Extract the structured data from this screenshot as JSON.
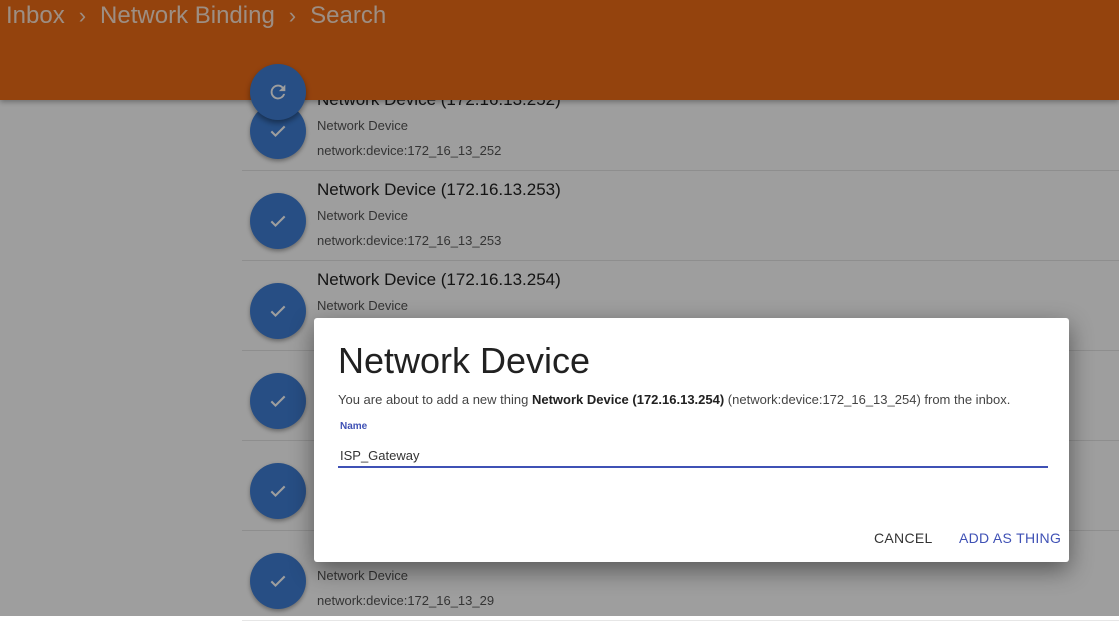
{
  "breadcrumb": {
    "items": [
      "Inbox",
      "Network Binding",
      "Search"
    ],
    "separator": "›"
  },
  "colors": {
    "appbar": "#ef6c16",
    "fab": "#3f7fd6",
    "accent": "#3f51b5"
  },
  "inbox": {
    "rows": [
      {
        "title": "Network Device (172.16.13.252)",
        "type": "Network Device",
        "uid": "network:device:172_16_13_252"
      },
      {
        "title": "Network Device (172.16.13.253)",
        "type": "Network Device",
        "uid": "network:device:172_16_13_253"
      },
      {
        "title": "Network Device (172.16.13.254)",
        "type": "Network Device",
        "uid": ""
      },
      {
        "title": "",
        "type": "",
        "uid": ""
      },
      {
        "title": "",
        "type": "",
        "uid": ""
      },
      {
        "title": "",
        "type": "Network Device",
        "uid": "network:device:172_16_13_29"
      }
    ]
  },
  "icons": {
    "refresh": "refresh-icon",
    "check": "check-icon"
  },
  "dialog": {
    "title": "Network Device",
    "message_prefix": "You are about to add a new thing ",
    "message_thing": "Network Device (172.16.13.254)",
    "message_suffix": " (network:device:172_16_13_254) from the inbox.",
    "name_label": "Name",
    "name_value": "ISP_Gateway",
    "cancel_label": "CANCEL",
    "add_label": "ADD AS THING"
  }
}
